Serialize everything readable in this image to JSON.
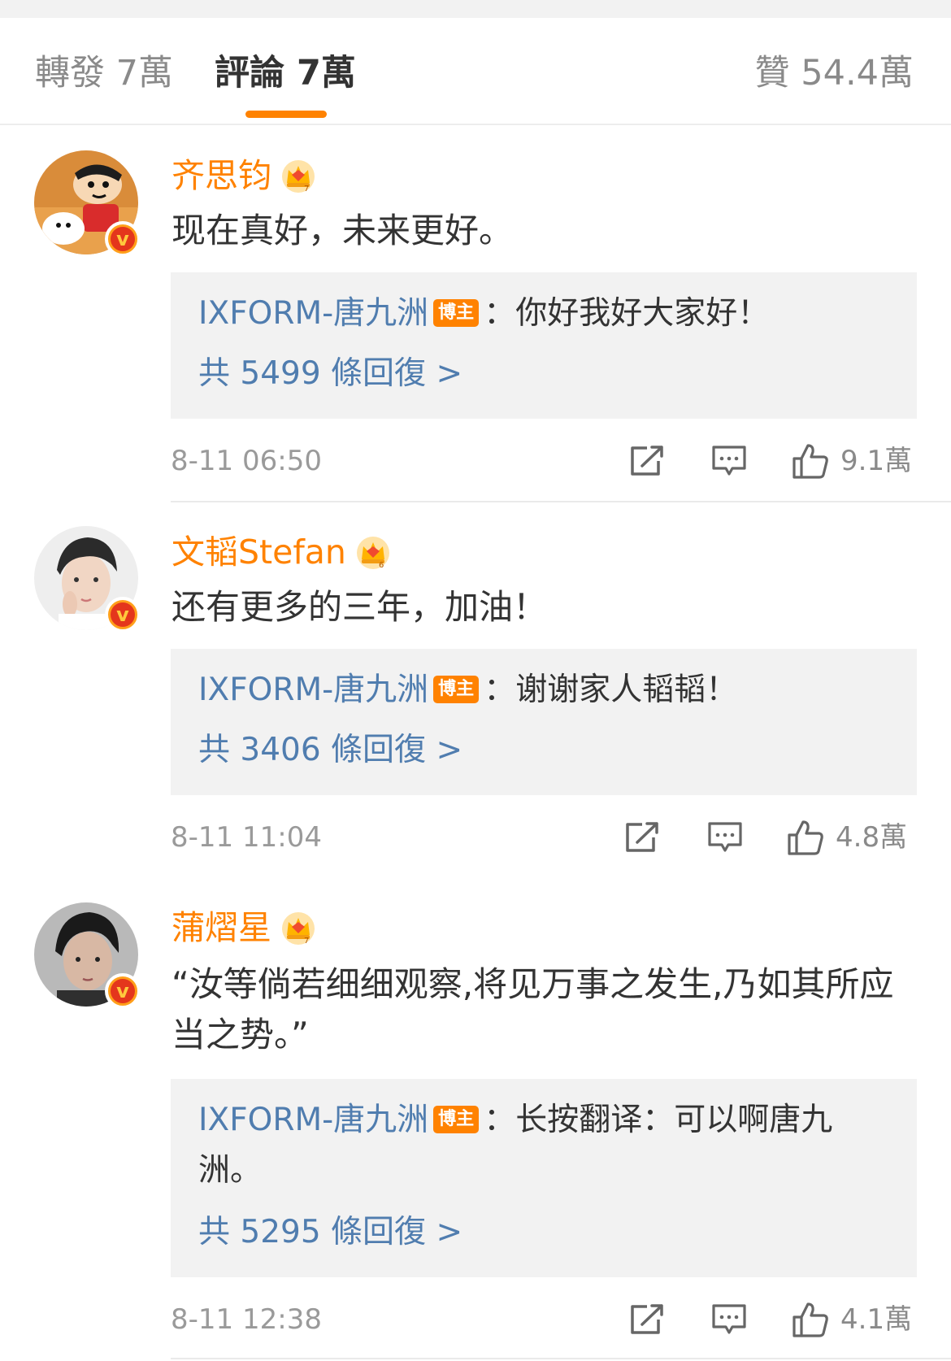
{
  "tabs": {
    "repost": "轉發 7萬",
    "comments": "評論 7萬",
    "likes": "贊 54.4萬"
  },
  "colors": {
    "accent": "#ff8200",
    "link_blue": "#507daf",
    "verified_badge": "#e4361c"
  },
  "op_tag": "博主",
  "comments": [
    {
      "user": "齐思钧",
      "text": "现在真好，未来更好。",
      "reply_user": "IXFORM-唐九洲",
      "reply_text": "：你好我好大家好！",
      "reply_count": "共 5499 條回復 >",
      "time": "8-11 06:50",
      "likes": "9.1萬"
    },
    {
      "user": "文韬Stefan",
      "text": "还有更多的三年，加油！",
      "reply_user": "IXFORM-唐九洲",
      "reply_text": "：谢谢家人韬韬！",
      "reply_count": "共 3406 條回復 >",
      "time": "8-11 11:04",
      "likes": "4.8萬"
    },
    {
      "user": "蒲熠星",
      "text": "“汝等倘若细细观察,将见万事之发生,乃如其所应当之势。”",
      "reply_user": "IXFORM-唐九洲",
      "reply_text": "：长按翻译：可以啊唐九洲。",
      "reply_count": "共 5295 條回復 >",
      "time": "8-11 12:38",
      "likes": "4.1萬"
    }
  ],
  "icons": {
    "share": "share-icon",
    "reply": "reply-icon",
    "like": "thumbs-up-icon",
    "verified": "verified-v-icon",
    "member": "crown-icon"
  }
}
